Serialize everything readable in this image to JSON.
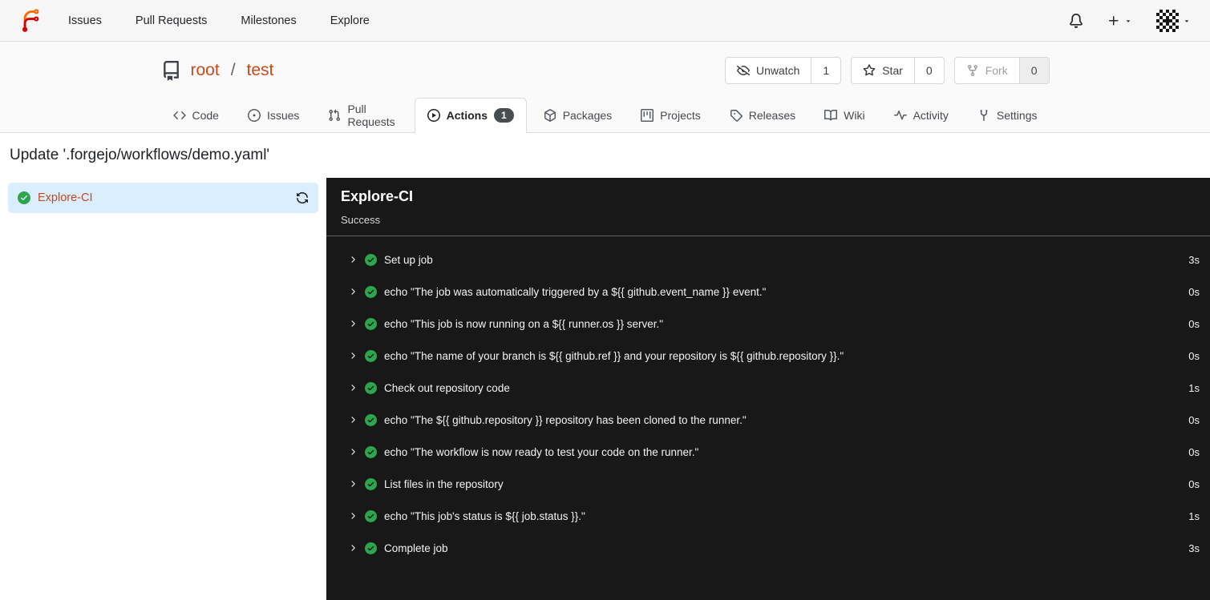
{
  "navbar": {
    "links": [
      {
        "label": "Issues"
      },
      {
        "label": "Pull Requests"
      },
      {
        "label": "Milestones"
      },
      {
        "label": "Explore"
      }
    ]
  },
  "repo_header": {
    "owner": "root",
    "separator": "/",
    "name": "test",
    "buttons": {
      "unwatch": {
        "label": "Unwatch",
        "count": "1"
      },
      "star": {
        "label": "Star",
        "count": "0"
      },
      "fork": {
        "label": "Fork",
        "count": "0",
        "disabled": true
      }
    }
  },
  "tabs": [
    {
      "label": "Code"
    },
    {
      "label": "Issues"
    },
    {
      "label": "Pull Requests"
    },
    {
      "label": "Actions",
      "badge": "1",
      "active": true
    },
    {
      "label": "Packages"
    },
    {
      "label": "Projects"
    },
    {
      "label": "Releases"
    },
    {
      "label": "Wiki"
    },
    {
      "label": "Activity"
    },
    {
      "label": "Settings"
    }
  ],
  "page": {
    "title": "Update '.forgejo/workflows/demo.yaml'"
  },
  "sidebar": {
    "job": {
      "name": "Explore-CI",
      "status": "success"
    }
  },
  "panel": {
    "title": "Explore-CI",
    "status": "Success",
    "steps": [
      {
        "name": "Set up job",
        "duration": "3s"
      },
      {
        "name": "echo \"The job was automatically triggered by a ${{ github.event_name }} event.\"",
        "duration": "0s"
      },
      {
        "name": "echo \"This job is now running on a ${{ runner.os }} server.\"",
        "duration": "0s"
      },
      {
        "name": "echo \"The name of your branch is ${{ github.ref }} and your repository is ${{ github.repository }}.\"",
        "duration": "0s"
      },
      {
        "name": "Check out repository code",
        "duration": "1s"
      },
      {
        "name": "echo \"The ${{ github.repository }} repository has been cloned to the runner.\"",
        "duration": "0s"
      },
      {
        "name": "echo \"The workflow is now ready to test your code on the runner.\"",
        "duration": "0s"
      },
      {
        "name": "List files in the repository",
        "duration": "0s"
      },
      {
        "name": "echo \"This job's status is ${{ job.status }}.\"",
        "duration": "1s"
      },
      {
        "name": "Complete job",
        "duration": "3s"
      }
    ]
  },
  "colors": {
    "primary": "#c8491a",
    "success_green": "#2da44e",
    "panel_bg": "#181818",
    "selected_job_bg": "#dbeefe"
  }
}
